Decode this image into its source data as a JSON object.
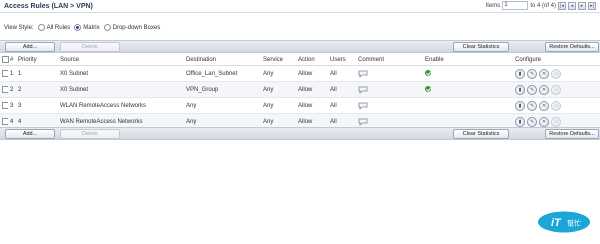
{
  "header": {
    "title": "Access Rules (LAN > VPN)",
    "items_label": "Items",
    "items_value": "1",
    "items_range": "to 4 (of 4)",
    "nav": [
      "|◂",
      "◂",
      "▸",
      "▸|"
    ]
  },
  "view_style": {
    "label": "View Style:",
    "options": [
      "All Rules",
      "Matrix",
      "Drop-down Boxes"
    ],
    "selected": "Matrix"
  },
  "toolbar": {
    "add_label": "Add...",
    "delete_label": "Delete",
    "clear_stats_label": "Clear Statistics",
    "restore_label": "Restore Defaults..."
  },
  "table": {
    "columns": [
      "#",
      "Priority",
      "Source",
      "Destination",
      "Service",
      "Action",
      "Users",
      "Comment",
      "Enable",
      "Configure"
    ],
    "rows": [
      {
        "num": "1",
        "priority": "1",
        "source": "X0 Subnet",
        "destination": "Office_Lan_Subnet",
        "service": "Any",
        "action": "Allow",
        "users": "All",
        "enabled": true
      },
      {
        "num": "2",
        "priority": "2",
        "source": "X0 Subnet",
        "destination": "VPN_Group",
        "service": "Any",
        "action": "Allow",
        "users": "All",
        "enabled": true
      },
      {
        "num": "3",
        "priority": "3",
        "source": "WLAN RemoteAccess Networks",
        "destination": "Any",
        "service": "Any",
        "action": "Allow",
        "users": "All",
        "enabled": false
      },
      {
        "num": "4",
        "priority": "4",
        "source": "WAN RemoteAccess Networks",
        "destination": "Any",
        "service": "Any",
        "action": "Allow",
        "users": "All",
        "enabled": false
      }
    ]
  },
  "watermark": {
    "text_latin": "iT",
    "text_cn": "幫忙"
  },
  "colors": {
    "allow": "#2f9a2f",
    "accent": "#2c4a7a",
    "watermark": "#1ba6d8"
  }
}
